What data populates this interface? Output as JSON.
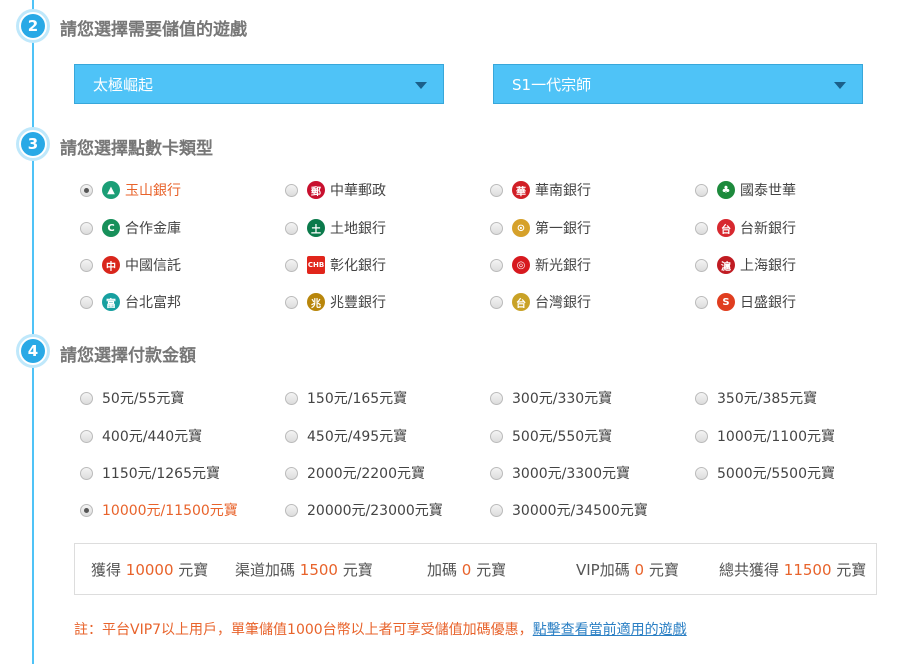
{
  "step2": {
    "number": "2",
    "title": "請您選擇需要儲值的遊戲",
    "game_select": "太極崛起",
    "server_select": "S1一代宗師"
  },
  "step3": {
    "number": "3",
    "title": "請您選擇點數卡類型",
    "banks": [
      {
        "label": "玉山銀行",
        "icon": "esun-bank-icon",
        "color": "#1b9e76",
        "glyph": "▲",
        "selected": true
      },
      {
        "label": "中華郵政",
        "icon": "chunghwa-post-icon",
        "color": "#c8102e",
        "glyph": "郵",
        "selected": false
      },
      {
        "label": "華南銀行",
        "icon": "huanan-bank-icon",
        "color": "#d11f26",
        "glyph": "華",
        "selected": false
      },
      {
        "label": "國泰世華",
        "icon": "cathay-bank-icon",
        "color": "#1d8a3c",
        "glyph": "♣",
        "selected": false
      },
      {
        "label": "合作金庫",
        "icon": "taiwan-cooperative-icon",
        "color": "#17905a",
        "glyph": "C",
        "selected": false
      },
      {
        "label": "土地銀行",
        "icon": "land-bank-icon",
        "color": "#0b7a4b",
        "glyph": "土",
        "selected": false
      },
      {
        "label": "第一銀行",
        "icon": "first-bank-icon",
        "color": "#d6a12a",
        "glyph": "⊙",
        "selected": false
      },
      {
        "label": "台新銀行",
        "icon": "taishin-bank-icon",
        "color": "#d7282f",
        "glyph": "台",
        "selected": false
      },
      {
        "label": "中國信託",
        "icon": "ctbc-bank-icon",
        "color": "#d9261c",
        "glyph": "中",
        "selected": false
      },
      {
        "label": "彰化銀行",
        "icon": "chb-bank-icon",
        "color": "#e1251b",
        "glyph": "CHB",
        "selected": false
      },
      {
        "label": "新光銀行",
        "icon": "shinkong-bank-icon",
        "color": "#d7191f",
        "glyph": "◎",
        "selected": false
      },
      {
        "label": "上海銀行",
        "icon": "shanghai-bank-icon",
        "color": "#c01b22",
        "glyph": "滬",
        "selected": false
      },
      {
        "label": "台北富邦",
        "icon": "fubon-bank-icon",
        "color": "#17a0a0",
        "glyph": "富",
        "selected": false
      },
      {
        "label": "兆豐銀行",
        "icon": "mega-bank-icon",
        "color": "#b8860b",
        "glyph": "兆",
        "selected": false
      },
      {
        "label": "台灣銀行",
        "icon": "bank-of-taiwan-icon",
        "color": "#c9a227",
        "glyph": "台",
        "selected": false
      },
      {
        "label": "日盛銀行",
        "icon": "jihsun-bank-icon",
        "color": "#e03d1f",
        "glyph": "S",
        "selected": false
      }
    ]
  },
  "step4": {
    "number": "4",
    "title": "請您選擇付款金額",
    "amounts": [
      {
        "label": "50元/55元寶",
        "selected": false
      },
      {
        "label": "150元/165元寶",
        "selected": false
      },
      {
        "label": "300元/330元寶",
        "selected": false
      },
      {
        "label": "350元/385元寶",
        "selected": false
      },
      {
        "label": "400元/440元寶",
        "selected": false
      },
      {
        "label": "450元/495元寶",
        "selected": false
      },
      {
        "label": "500元/550元寶",
        "selected": false
      },
      {
        "label": "1000元/1100元寶",
        "selected": false
      },
      {
        "label": "1150元/1265元寶",
        "selected": false
      },
      {
        "label": "2000元/2200元寶",
        "selected": false
      },
      {
        "label": "3000元/3300元寶",
        "selected": false
      },
      {
        "label": "5000元/5500元寶",
        "selected": false
      },
      {
        "label": "10000元/11500元寶",
        "selected": true
      },
      {
        "label": "20000元/23000元寶",
        "selected": false
      },
      {
        "label": "30000元/34500元寶",
        "selected": false
      }
    ]
  },
  "summary": {
    "get_label": "獲得",
    "get_value": "10000",
    "get_unit": "元寶",
    "channel_label": "渠道加碼",
    "channel_value": "1500",
    "channel_unit": "元寶",
    "bonus_label": "加碼",
    "bonus_value": "0",
    "bonus_unit": "元寶",
    "vip_label": "VIP加碼",
    "vip_value": "0",
    "vip_unit": "元寶",
    "total_label": "總共獲得",
    "total_value": "11500",
    "total_unit": "元寶"
  },
  "note": {
    "text": "註：平台VIP7以上用戶，單筆儲值1000台幣以上者可享受儲值加碼優惠，",
    "link": "點擊查看當前適用的遊戲"
  },
  "colors": {
    "accent": "#4fc3f7",
    "highlight": "#e8632b",
    "link": "#2a7fc4"
  }
}
